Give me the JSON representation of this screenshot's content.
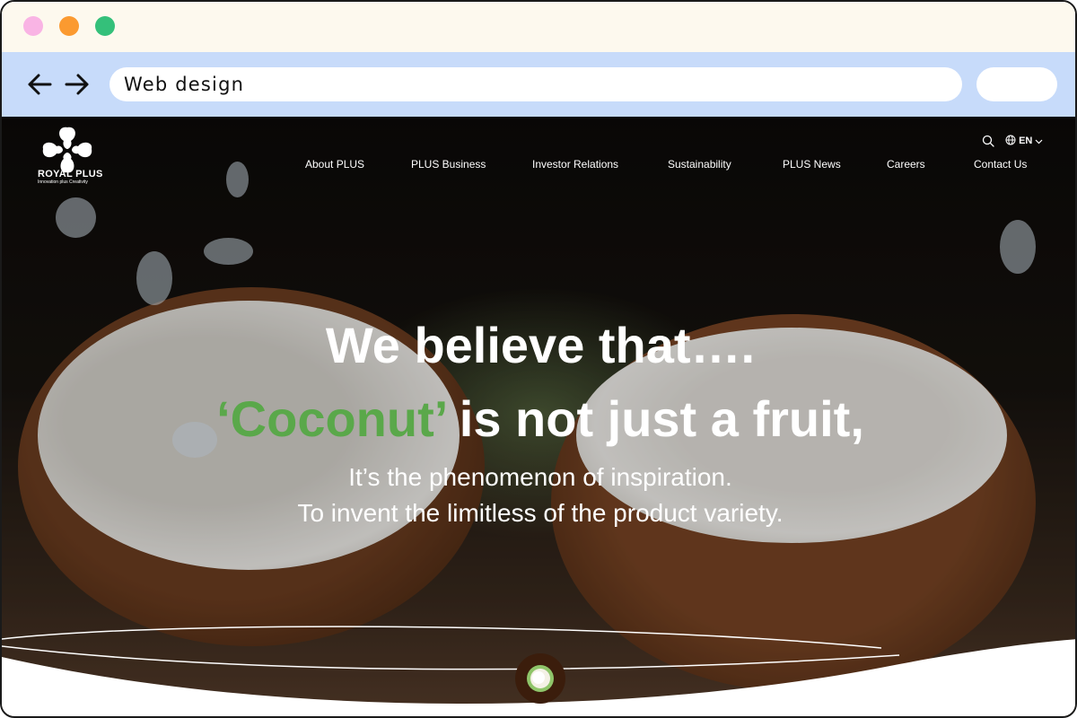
{
  "browser": {
    "url": "Web design"
  },
  "site": {
    "logo_name": "ROYAL PLUS",
    "logo_tagline": "Innovation plus Creativity",
    "menu": [
      {
        "label": "About PLUS"
      },
      {
        "label": "PLUS Business"
      },
      {
        "label": "Investor Relations"
      },
      {
        "label": "Sustainability"
      },
      {
        "label": "PLUS News"
      },
      {
        "label": "Careers"
      },
      {
        "label": "Contact Us"
      }
    ],
    "language": "EN",
    "icons": [
      "search-icon",
      "globe-icon",
      "chevron-down-icon"
    ]
  },
  "hero": {
    "line1": "We believe that….",
    "highlight": "‘Coconut’",
    "line2_rest": " is not just a fruit,",
    "sub1": "It’s the phenomenon of inspiration.",
    "sub2": "To invent the limitless of the product variety."
  },
  "colors": {
    "titlebar": "#fdf9ee",
    "addressbar": "#c7dbfa",
    "dot_pink": "#f9b4e4",
    "dot_orange": "#fb9a30",
    "dot_green": "#34c07a",
    "accent_green": "#5aa84a"
  }
}
